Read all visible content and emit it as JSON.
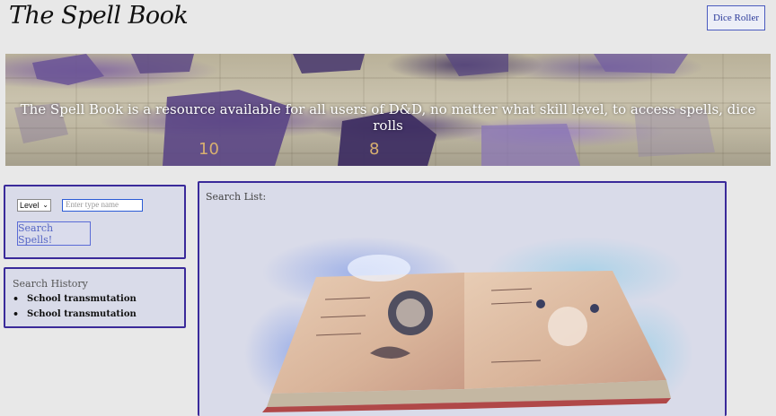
{
  "header": {
    "logo": "The Spell Book",
    "dice_button": "Dice Roller"
  },
  "hero": {
    "text": "The Spell Book is a resource available for all users of D&D, no matter what skill level, to access spells, dice rolls"
  },
  "search": {
    "level_selected": "Level",
    "name_placeholder": "Enter type name",
    "button": "Search Spells!"
  },
  "history": {
    "title": "Search History",
    "items": [
      "School transmutation",
      "School transmutation"
    ]
  },
  "results": {
    "title": "Search List:"
  },
  "colors": {
    "panel_border": "#3a2a9a",
    "panel_bg": "#d9dbe9",
    "accent": "#4a5bbf",
    "page_bg": "#e8e8e8"
  }
}
